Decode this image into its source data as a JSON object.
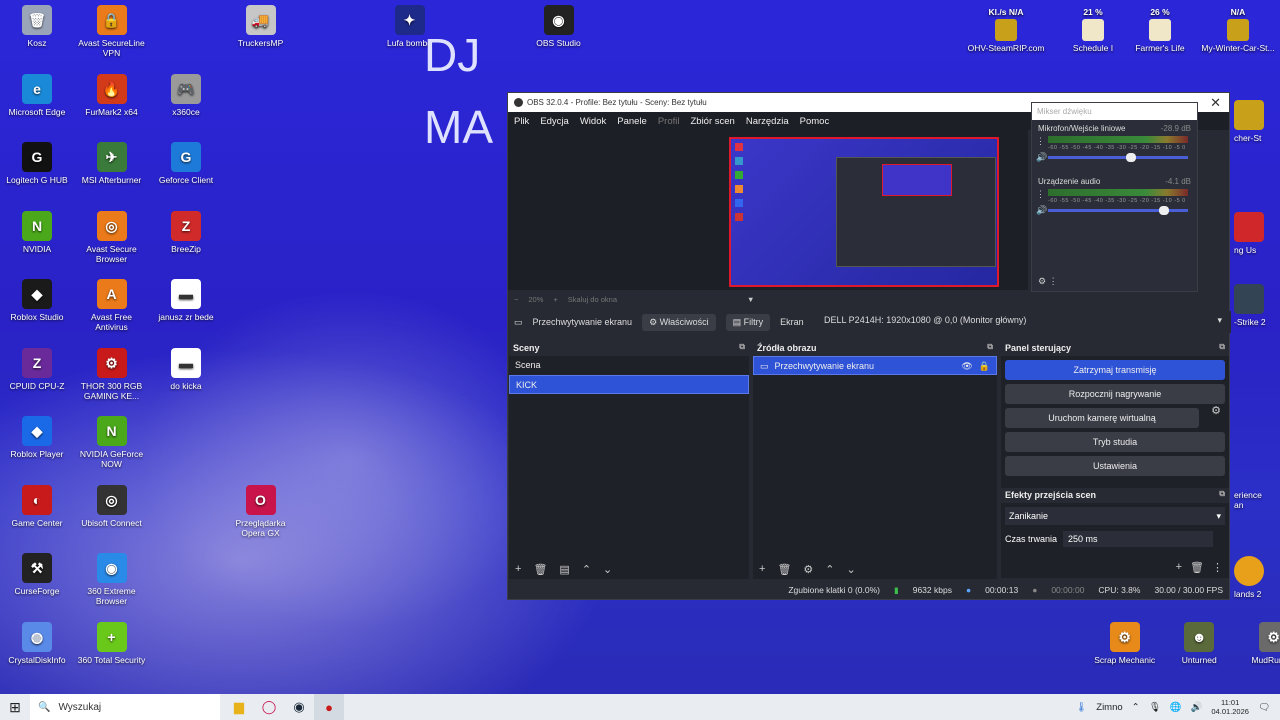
{
  "desktop": {
    "icons": [
      {
        "label": "Kosz",
        "color": "#9aa4b8",
        "glyph": "🗑"
      },
      {
        "label": "Avast SecureLine VPN",
        "color": "#ea7a1a",
        "glyph": "🔒"
      },
      {
        "label": "TruckersMP",
        "color": "#c7c7c7",
        "glyph": "🚚"
      },
      {
        "label": "Lufa bombe",
        "color": "#1e2a8a",
        "glyph": "✦"
      },
      {
        "label": "OBS Studio",
        "color": "#222222",
        "glyph": "◉"
      },
      {
        "label": "Microsoft Edge",
        "color": "#1a8ad8",
        "glyph": "e"
      },
      {
        "label": "FurMark2 x64",
        "color": "#d23a1a",
        "glyph": "🔥"
      },
      {
        "label": "x360ce",
        "color": "#9a9a9a",
        "glyph": "🎮"
      },
      {
        "label": "Logitech G HUB",
        "color": "#111111",
        "glyph": "G"
      },
      {
        "label": "MSI Afterburner",
        "color": "#3a7a3a",
        "glyph": "✈"
      },
      {
        "label": "Geforce Client",
        "color": "#1e7ad8",
        "glyph": "G"
      },
      {
        "label": "NVIDIA",
        "color": "#4aa81a",
        "glyph": "N"
      },
      {
        "label": "Avast Secure Browser",
        "color": "#ea7a1a",
        "glyph": "◎"
      },
      {
        "label": "BreeZip",
        "color": "#d02a2a",
        "glyph": "Z"
      },
      {
        "label": "Roblox Studio",
        "color": "#1a1a1a",
        "glyph": "◆"
      },
      {
        "label": "Avast Free Antivirus",
        "color": "#ea7a1a",
        "glyph": "A"
      },
      {
        "label": "janusz zr bede",
        "color": "#ffffff",
        "glyph": "▬"
      },
      {
        "label": "CPUID CPU-Z",
        "color": "#6a2a9a",
        "glyph": "Z"
      },
      {
        "label": "THOR 300 RGB GAMING KE...",
        "color": "#c81a1a",
        "glyph": "⚙"
      },
      {
        "label": "do kicka",
        "color": "#ffffff",
        "glyph": "▬"
      },
      {
        "label": "Roblox Player",
        "color": "#1a6ae8",
        "glyph": "◆"
      },
      {
        "label": "NVIDIA GeForce NOW",
        "color": "#4aa81a",
        "glyph": "N"
      },
      {
        "label": "Game Center",
        "color": "#c81a1a",
        "glyph": "◐"
      },
      {
        "label": "Ubisoft Connect",
        "color": "#333333",
        "glyph": "◎"
      },
      {
        "label": "Przeglądarka Opera GX",
        "color": "#c8144a",
        "glyph": "O"
      },
      {
        "label": "CurseForge",
        "color": "#222222",
        "glyph": "⚒"
      },
      {
        "label": "360 Extreme Browser",
        "color": "#2a8ae8",
        "glyph": "◉"
      },
      {
        "label": "CrystalDiskInfo",
        "color": "#5a8ae8",
        "glyph": "◍"
      },
      {
        "label": "360 Total Security",
        "color": "#6ac81a",
        "glyph": "+"
      },
      {
        "label": "Scrap Mechanic",
        "color": "#e88a1a",
        "glyph": "⚙"
      },
      {
        "label": "Unturned",
        "color": "#5a6a3a",
        "glyph": "☻"
      },
      {
        "label": "MudRunner",
        "color": "#6a6a6a",
        "glyph": "⚙"
      }
    ],
    "top_right": [
      {
        "label": "OHV-SteamRIP.com",
        "extra": "Kl./s N/A"
      },
      {
        "label": "Schedule I",
        "extra": "21 %"
      },
      {
        "label": "Farmer's Life",
        "extra": "26 %"
      },
      {
        "label": "My-Winter-Car-St...",
        "extra": "N/A"
      }
    ],
    "overlay_text": {
      "line1": "DJ",
      "line2": "MA"
    },
    "side_partial": [
      "cher-St",
      "ng Us",
      "-Strike 2",
      "erience",
      "an",
      "lands 2"
    ]
  },
  "obs": {
    "title": "OBS 32.0.4 - Profile: Bez tytułu - Sceny: Bez tytułu",
    "menu": [
      "Plik",
      "Edycja",
      "Widok",
      "Panele",
      "Profil",
      "Zbiór scen",
      "Narzędzia",
      "Pomoc"
    ],
    "preview_zoom": "20%",
    "preview_scale": "Skaluj do okna",
    "mixer": {
      "title": "Mikser dźwięku",
      "tracks": [
        {
          "name": "Mikrofon/Wejście liniowe",
          "db": "-28.9 dB",
          "level": 0.6
        },
        {
          "name": "Urządzenie audio",
          "db": "-4.1 dB",
          "level": 0.85
        }
      ],
      "scale": "-60 -55 -50 -45 -40 -35 -30 -25 -20 -15 -10 -5 0"
    },
    "source_toolbar": {
      "source": "Przechwytywanie ekranu",
      "properties": "Właściwości",
      "filters": "Filtry",
      "screen_label": "Ekran",
      "monitor": "DELL P2414H: 1920x1080 @ 0,0 (Monitor główny)"
    },
    "scenes": {
      "title": "Sceny",
      "items": [
        "Scena",
        "KICK"
      ]
    },
    "sources": {
      "title": "Źródła obrazu",
      "items": [
        "Przechwytywanie ekranu"
      ]
    },
    "controls": {
      "title": "Panel sterujący",
      "buttons": [
        "Zatrzymaj transmisję",
        "Rozpocznij nagrywanie",
        "Uruchom kamerę wirtualną",
        "Tryb studia",
        "Ustawienia"
      ]
    },
    "transitions": {
      "title": "Efekty przejścia scen",
      "selected": "Zanikanie",
      "duration_label": "Czas trwania",
      "duration": "250 ms"
    },
    "status": {
      "dropped": "Zgubione klatki 0 (0.0%)",
      "bitrate": "9632 kbps",
      "live_time": "00:00:13",
      "rec_time": "00:00:00",
      "cpu": "CPU: 3.8%",
      "fps": "30.00 / 30.00 FPS"
    }
  },
  "taskbar": {
    "search_placeholder": "Wyszukaj",
    "weather": "Zimno",
    "time": "11:01",
    "date": "04.01.2026"
  }
}
